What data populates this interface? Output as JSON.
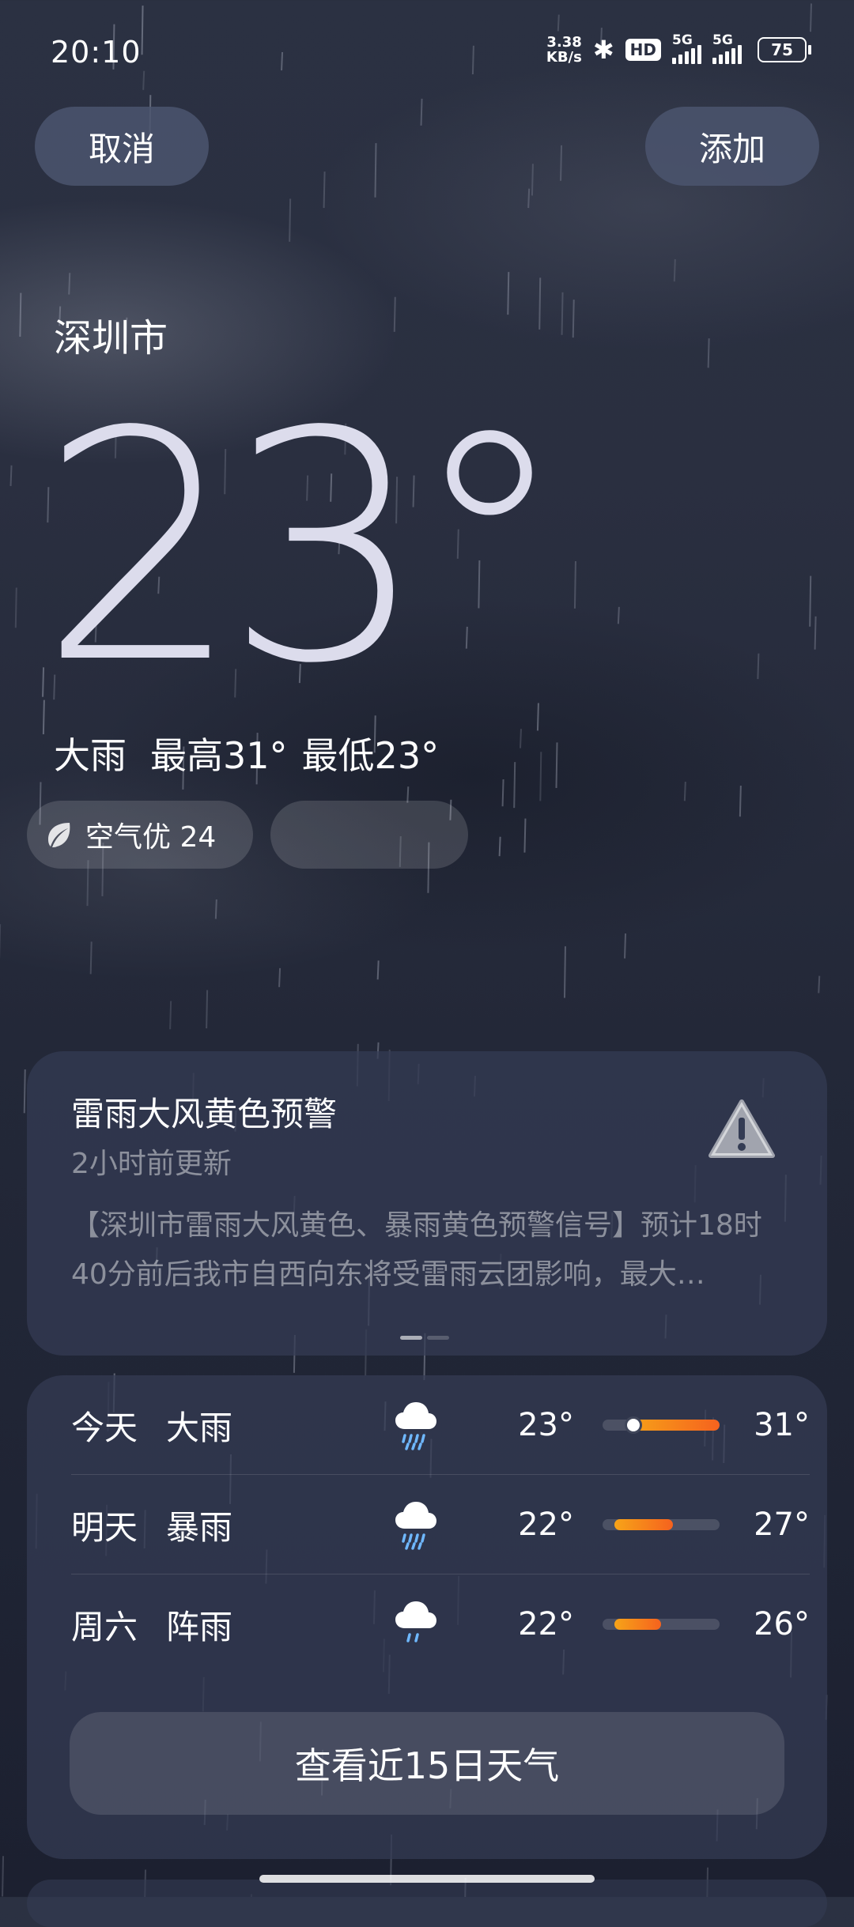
{
  "status_bar": {
    "time": "20:10",
    "net_speed_value": "3.38",
    "net_speed_unit": "KB/s",
    "bluetooth_glyph": "✱",
    "hd_label": "HD",
    "signal1_label": "5G",
    "signal2_label": "5G",
    "battery": "75"
  },
  "header": {
    "cancel_label": "取消",
    "add_label": "添加"
  },
  "location": {
    "city": "深圳市"
  },
  "current": {
    "temperature": "23°",
    "condition": "大雨",
    "high": "最高31°",
    "low": "最低23°"
  },
  "air_quality": {
    "label": "空气优 24",
    "icon": "leaf-icon"
  },
  "alert": {
    "title": "雷雨大风黄色预警",
    "updated": "2小时前更新",
    "body": "【深圳市雷雨大风黄色、暴雨黄色预警信号】预计18时40分前后我市自西向东将受雷雨云团影响，最大…",
    "icon": "warning-triangle-icon"
  },
  "forecast": {
    "days": [
      {
        "day": "今天",
        "condition": "大雨",
        "low": "23°",
        "high": "31°",
        "low_value": 23,
        "high_value": 31,
        "icon": "heavy-rain-icon",
        "current_marker": true
      },
      {
        "day": "明天",
        "condition": "暴雨",
        "low": "22°",
        "high": "27°",
        "low_value": 22,
        "high_value": 27,
        "icon": "storm-rain-icon",
        "current_marker": false
      },
      {
        "day": "周六",
        "condition": "阵雨",
        "low": "22°",
        "high": "26°",
        "low_value": 22,
        "high_value": 26,
        "icon": "shower-rain-icon",
        "current_marker": false
      }
    ],
    "button_label": "查看近15日天气"
  },
  "colors": {
    "bar_start": "#f7a418",
    "bar_end": "#f5621e",
    "card_bg": "#343c54"
  }
}
